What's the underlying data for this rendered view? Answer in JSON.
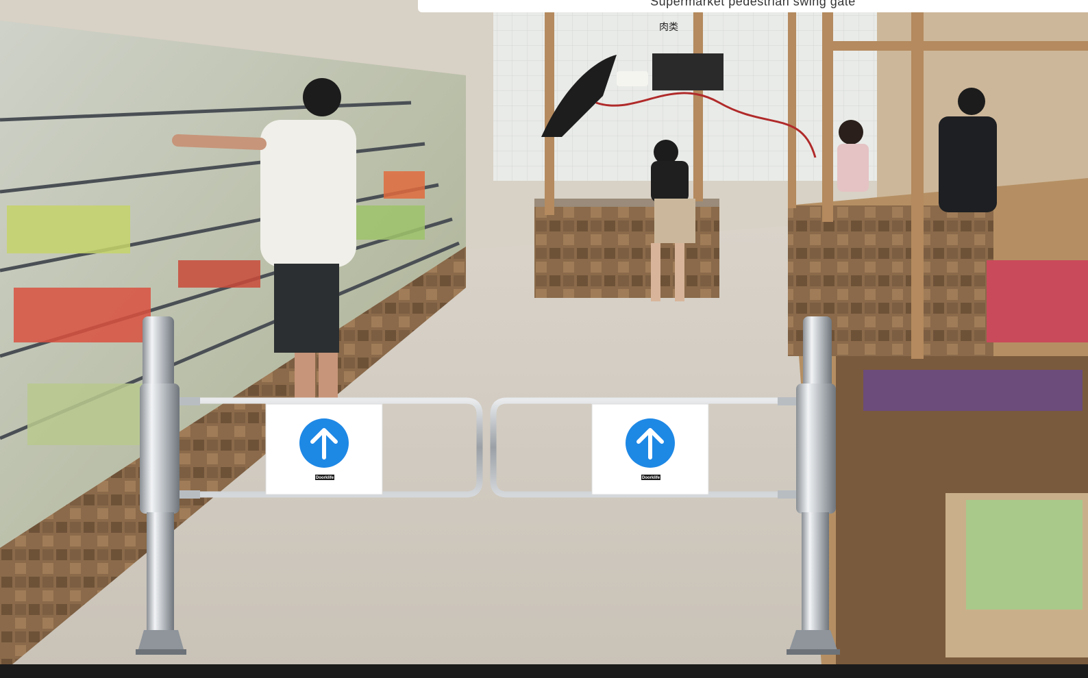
{
  "caption": {
    "text": "Supermarket pedestrian swing gate"
  },
  "signage": {
    "meat_section": "肉类"
  },
  "gate": {
    "left_panel": {
      "icon": "arrow-up-icon",
      "brand": "Doorklife"
    },
    "right_panel": {
      "icon": "arrow-up-icon",
      "brand": "Doorklife"
    },
    "accent_color": "#1e88e5"
  }
}
